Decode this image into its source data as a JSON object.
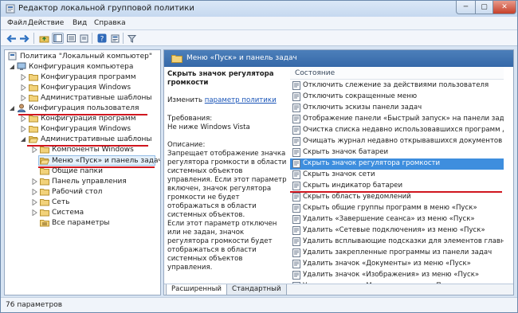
{
  "window": {
    "title": "Редактор локальной групповой политики",
    "min_label": "─",
    "max_label": "▢",
    "close_label": "✕"
  },
  "menu": [
    "Файл",
    "Действие",
    "Вид",
    "Справка"
  ],
  "tree": {
    "items": [
      {
        "label": "Политика \"Локальный компьютер\"",
        "icon": "computer-policy-icon"
      },
      {
        "label": "Конфигурация компьютера",
        "icon": "computer-icon"
      },
      {
        "label": "Конфигурация программ",
        "icon": "folder-icon"
      },
      {
        "label": "Конфигурация Windows",
        "icon": "folder-icon"
      },
      {
        "label": "Административные шаблоны",
        "icon": "folder-icon"
      },
      {
        "label": "Конфигурация пользователя",
        "icon": "user-icon"
      },
      {
        "label": "Конфигурация программ",
        "icon": "folder-icon"
      },
      {
        "label": "Конфигурация Windows",
        "icon": "folder-icon"
      },
      {
        "label": "Административные шаблоны",
        "icon": "folder-open-icon"
      },
      {
        "label": "Компоненты Windows",
        "icon": "folder-icon"
      },
      {
        "label": "Меню «Пуск» и панель задач",
        "icon": "folder-open-icon"
      },
      {
        "label": "Общие папки",
        "icon": "folder-icon"
      },
      {
        "label": "Панель управления",
        "icon": "folder-icon"
      },
      {
        "label": "Рабочий стол",
        "icon": "folder-icon"
      },
      {
        "label": "Сеть",
        "icon": "folder-icon"
      },
      {
        "label": "Система",
        "icon": "folder-icon"
      },
      {
        "label": "Все параметры",
        "icon": "settings-list-icon"
      }
    ]
  },
  "details": {
    "header_title": "Меню «Пуск» и панель задач",
    "setting_title": "Скрыть значок регулятора громкости",
    "edit_prefix": "Изменить",
    "edit_link": "параметр политики",
    "requirements_label": "Требования:",
    "requirements_value": "Не ниже Windows Vista",
    "description_label": "Описание:",
    "description_p1": "Запрещает отображение значка регулятора громкости в области системных объектов управления. Если этот параметр включен, значок регулятора громкости не будет отображаться в области системных объектов.",
    "description_p2": "Если этот параметр отключен или не задан, значок регулятора громкости будет отображаться в области системных объектов управления."
  },
  "list": {
    "column_header": "Состояние",
    "selected_index": 7,
    "items": [
      "Отключить слежение за действиями пользователя",
      "Отключить сокращенные меню",
      "Отключить эскизы панели задач",
      "Отображение панели «Быстрый запуск» на панели задач",
      "Очистка списка недавно использовавшихся программ д...",
      "Очищать журнал недавно открывавшихся документов п...",
      "Скрыть значок батареи",
      "Скрыть значок регулятора громкости",
      "Скрыть значок сети",
      "Скрыть индикатор батареи",
      "Скрыть область уведомлений",
      "Скрыть общие группы программ в меню «Пуск»",
      "Удалить «Завершение сеанса» из меню «Пуск»",
      "Удалить «Сетевые подключения» из меню «Пуск»",
      "Удалить всплывающие подсказки для элементов главног...",
      "Удалить закрепленные программы из панели задач",
      "Удалить значок «Документы» из меню «Пуск»",
      "Удалить значок «Изображения» из меню «Пуск»",
      "Удалить значок «Музыка» из меню «Пуск»"
    ]
  },
  "tabs": [
    "Расширенный",
    "Стандартный"
  ],
  "status": {
    "text": "76 параметров"
  },
  "colors": {
    "accent_header": "#3b6eab",
    "selection": "#3e8ede",
    "annotation_red": "#d0161f"
  }
}
